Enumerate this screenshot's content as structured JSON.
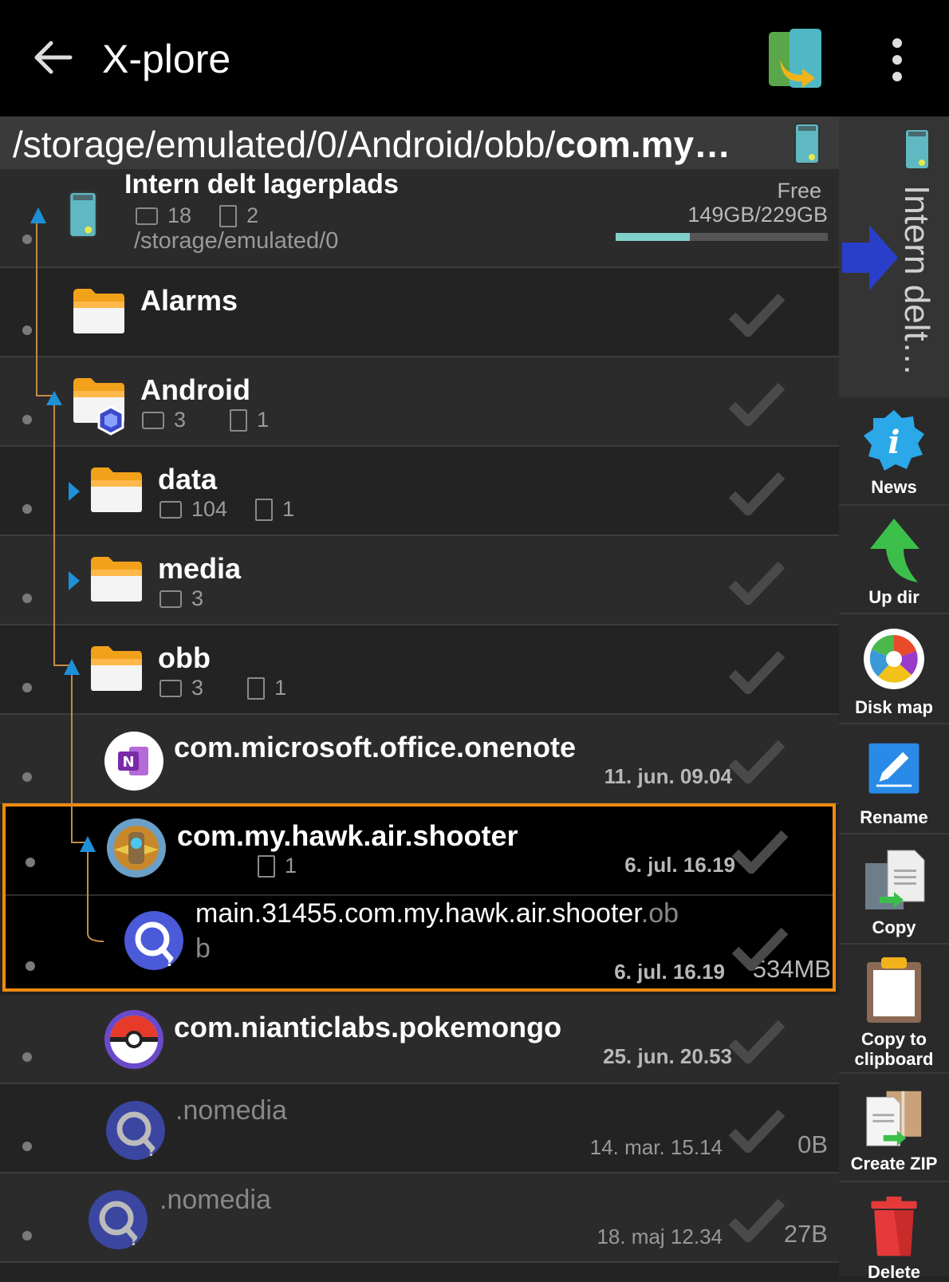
{
  "app": {
    "title": "X-plore"
  },
  "path": {
    "prefix": "/storage/emulated/0/Android/obb/",
    "bold": "com.my…"
  },
  "sidepanel": {
    "label": "Intern delt…"
  },
  "storage": {
    "name": "Intern delt lagerplads",
    "folders": "18",
    "files": "2",
    "path": "/storage/emulated/0",
    "free_label": "Free",
    "free_value": "149GB/229GB",
    "free_fraction": 0.35
  },
  "rows": {
    "alarms": {
      "name": "Alarms"
    },
    "android": {
      "name": "Android",
      "folders": "3",
      "files": "1"
    },
    "data": {
      "name": "data",
      "folders": "104",
      "files": "1"
    },
    "media": {
      "name": "media",
      "folders": "3"
    },
    "obb": {
      "name": "obb",
      "folders": "3",
      "files": "1"
    },
    "onenote": {
      "name": "com.microsoft.office.onenote",
      "date": "11. jun. 09.04"
    },
    "hawk": {
      "name": "com.my.hawk.air.shooter",
      "files": "1",
      "date": "6. jul. 16.19"
    },
    "mainfile": {
      "name_main": "main.31455.com.my.hawk.air.shooter",
      "name_ext_a": ".ob",
      "name_ext_b": "b",
      "date": "6. jul. 16.19",
      "size": "534MB"
    },
    "pokemon": {
      "name": "com.nianticlabs.pokemongo",
      "date": "25. jun. 20.53"
    },
    "nomedia1": {
      "name": ".nomedia",
      "date": "14. mar. 15.14",
      "size": "0B"
    },
    "nomedia2": {
      "name": ".nomedia",
      "date": "18. maj 12.34",
      "size": "27B"
    }
  },
  "toolbar": {
    "news": "News",
    "updir": "Up dir",
    "diskmap": "Disk map",
    "rename": "Rename",
    "copy": "Copy",
    "copy_clipboard_1": "Copy to",
    "copy_clipboard_2": "clipboard",
    "createzip": "Create ZIP",
    "delete": "Delete"
  },
  "colors": {
    "accent_orange": "#f08a10",
    "folder": "#ffa726",
    "tree_line": "#c48a4a",
    "arrow_blue": "#1e90d8"
  },
  "icons": {
    "back": "arrow-left-icon",
    "pane": "dual-pane-icon",
    "more": "more-vert-icon",
    "check": "checkmark-icon",
    "folder": "folder-icon"
  }
}
